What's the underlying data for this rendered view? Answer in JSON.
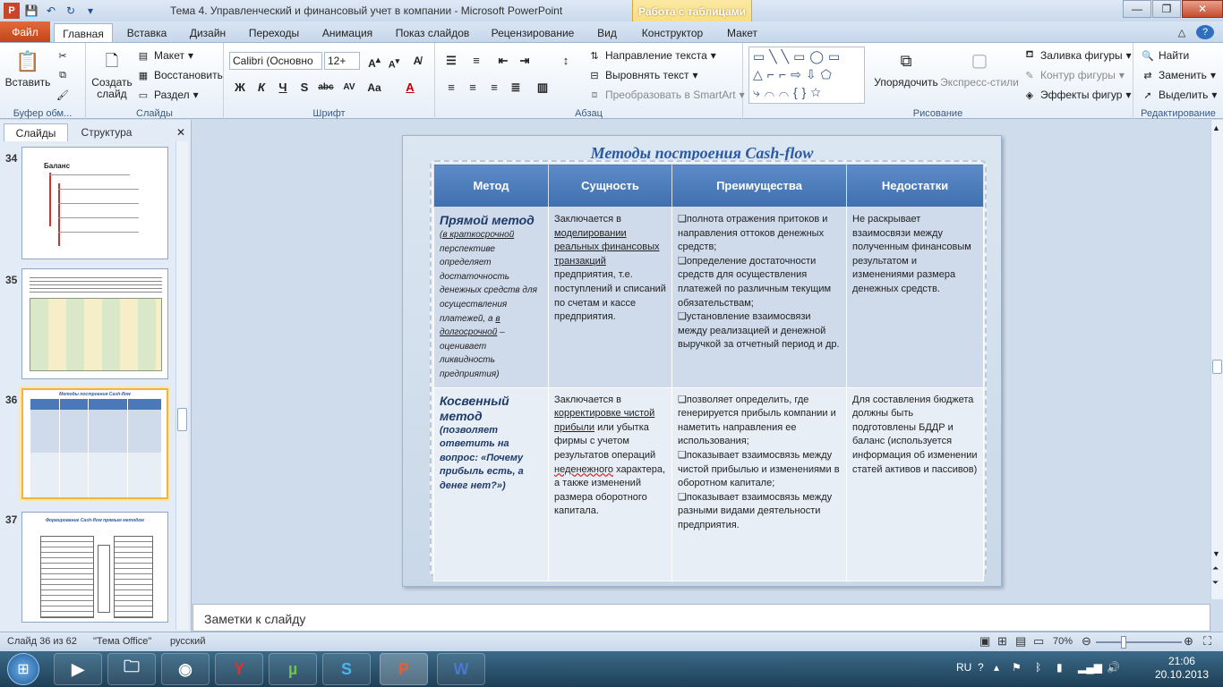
{
  "window": {
    "title": "Тема 4. Управленческий и финансовый учет в компании  -  Microsoft PowerPoint",
    "context_group": "Работа с таблицами"
  },
  "tabs": [
    "Файл",
    "Главная",
    "Вставка",
    "Дизайн",
    "Переходы",
    "Анимация",
    "Показ слайдов",
    "Рецензирование",
    "Вид",
    "Конструктор",
    "Макет"
  ],
  "ribbon": {
    "clipboard": {
      "label": "Буфер обм...",
      "paste": "Вставить"
    },
    "slides": {
      "label": "Слайды",
      "new_slide": "Создать слайд",
      "layout": "Макет",
      "reset": "Восстановить",
      "section": "Раздел"
    },
    "font": {
      "label": "Шрифт",
      "font_name": "Calibri (Основно",
      "font_size": "12+"
    },
    "paragraph": {
      "label": "Абзац",
      "text_direction": "Направление текста",
      "align_text": "Выровнять текст",
      "smartart": "Преобразовать в SmartArt"
    },
    "drawing": {
      "label": "Рисование",
      "arrange": "Упорядочить",
      "quick_styles": "Экспресс-стили",
      "shape_fill": "Заливка фигуры",
      "shape_outline": "Контур фигуры",
      "shape_effects": "Эффекты фигур"
    },
    "editing": {
      "label": "Редактирование",
      "find": "Найти",
      "replace": "Заменить",
      "select": "Выделить"
    }
  },
  "left_panel": {
    "tab_slides": "Слайды",
    "tab_outline": "Структура",
    "thumbnails": [
      {
        "num": "34",
        "title": "Баланс"
      },
      {
        "num": "35",
        "title": ""
      },
      {
        "num": "36",
        "title": "Методы построения Cash-flow"
      },
      {
        "num": "37",
        "title": "Формирование Cash-flow прямым методом"
      }
    ]
  },
  "slide": {
    "title": "Методы построения  Cash-flow",
    "headers": [
      "Метод",
      "Сущность",
      "Преимущества",
      "Недостатки"
    ],
    "row1": {
      "method_name": "Прямой метод",
      "method_note_a": "(в краткосрочной",
      "method_note_b": "перспективе определяет достаточность денежных средств для осуществления платежей, а",
      "method_note_c": "в долгосрочной",
      "method_note_d": "– оценивает ликвидность предприятия)",
      "essence_a": "Заключается в",
      "essence_b": "моделировании реальных финансовых транзакций",
      "essence_c": "предприятия, т.е. поступлений и списаний по счетам и кассе предприятия.",
      "adv_1": "❑полнота отражения притоков и направления оттоков денежных средств;",
      "adv_2": "❑определение достаточности средств для осуществления платежей по различным текущим обязательствам;",
      "adv_3": "❑установление взаимосвязи между реализацией и денежной выручкой за отчетный период и др.",
      "dis": "Не раскрывает взаимосвязи между полученным финансовым результатом и изменениями размера денежных средств."
    },
    "row2": {
      "method_name": "Косвенный метод",
      "method_note": "(позволяет ответить  на вопрос:  «Почему прибыль есть,  а денег нет?»)",
      "essence_a": "Заключается в",
      "essence_b": "корректировке чистой прибыли",
      "essence_c": "или убытка фирмы с учетом результатов операций",
      "essence_d": "неденежного",
      "essence_e": "характера, а также изменений размера оборотного капитала.",
      "adv_1": "❑позволяет определить, где генерируется прибыль компании и наметить направления ее использования;",
      "adv_2": "❑показывает взаимосвязь между чистой прибылью и изменениями в оборотном капитале;",
      "adv_3": "❑показывает взаимосвязь между разными видами деятельности предприятия.",
      "dis": "Для составления бюджета должны быть подготовлены БДДР и баланс (используется информация об изменении статей активов и пассивов)"
    }
  },
  "notes": {
    "placeholder": "Заметки к слайду"
  },
  "status": {
    "slide_of": "Слайд 36 из 62",
    "theme": "\"Тема Office\"",
    "language": "русский",
    "zoom": "70%"
  },
  "taskbar": {
    "lang": "RU",
    "time": "21:06",
    "date": "20.10.2013"
  }
}
